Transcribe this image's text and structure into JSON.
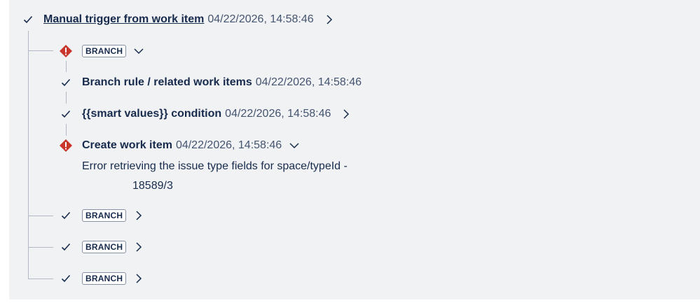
{
  "trigger": {
    "title": "Manual trigger from work item",
    "timestamp": "04/22/2026, 14:58:46"
  },
  "branch_label": "BRANCH",
  "branch_main": {
    "label": "BRANCH",
    "steps": [
      {
        "title": "Branch rule / related work items",
        "timestamp": "04/22/2026, 14:58:46"
      },
      {
        "title": "{{smart values}} condition",
        "timestamp": "04/22/2026, 14:58:46"
      },
      {
        "title": "Create work item",
        "timestamp": "04/22/2026, 14:58:46",
        "error_line1": "Error retrieving the issue type fields for space/typeId -",
        "error_line2": "18589/3"
      }
    ]
  },
  "branches": [
    {
      "label": "BRANCH"
    },
    {
      "label": "BRANCH"
    },
    {
      "label": "BRANCH"
    }
  ],
  "colors": {
    "success": "#172b4d",
    "error": "#c9372c",
    "line": "#b3b9c4"
  }
}
